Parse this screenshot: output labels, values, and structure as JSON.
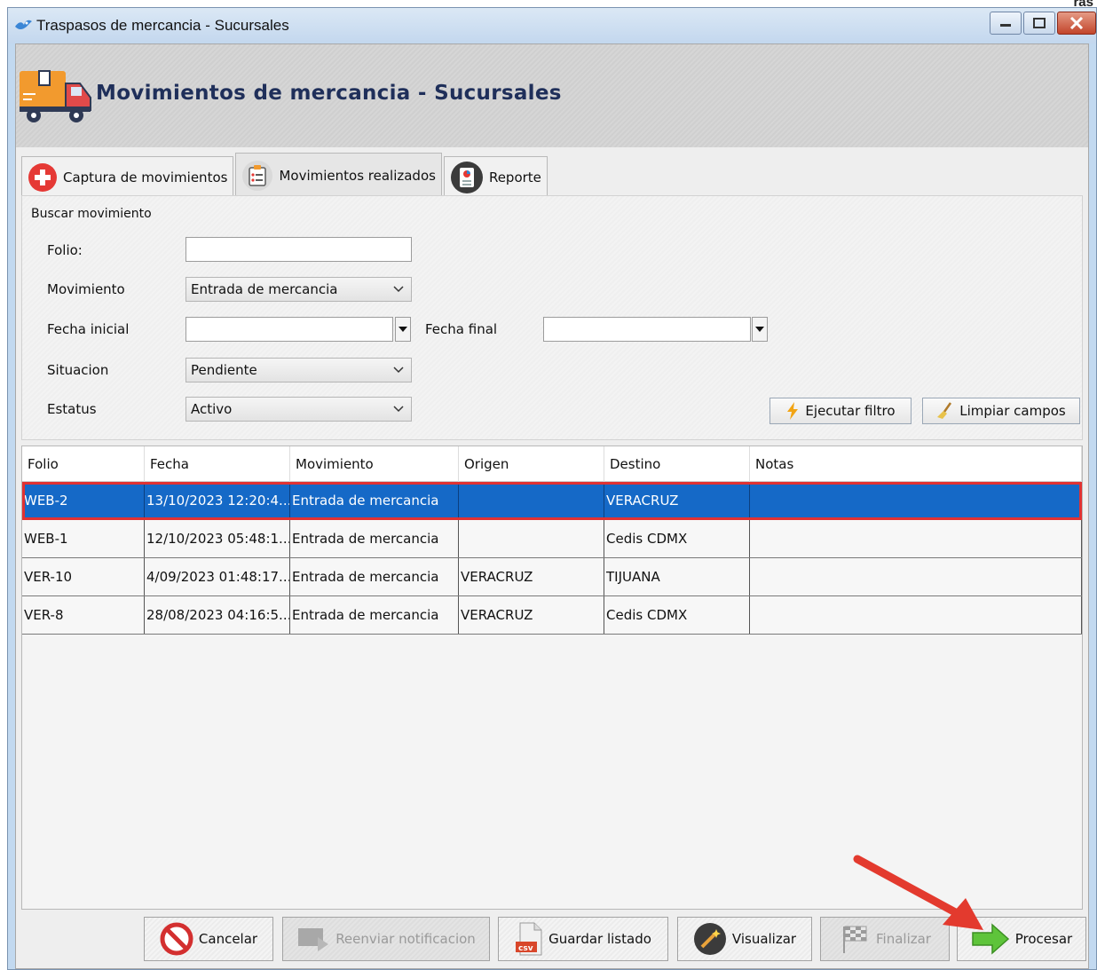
{
  "corner_text": "ras",
  "window": {
    "title": "Traspasos de mercancia - Sucursales"
  },
  "header": {
    "title": "Movimientos de mercancia - Sucursales"
  },
  "tabs": [
    {
      "label": "Captura de movimientos"
    },
    {
      "label": "Movimientos realizados"
    },
    {
      "label": "Reporte"
    }
  ],
  "filter": {
    "group_label": "Buscar movimiento",
    "folio_label": "Folio:",
    "folio_value": "",
    "movimiento_label": "Movimiento",
    "movimiento_value": "Entrada de mercancia",
    "fecha_inicial_label": "Fecha inicial",
    "fecha_inicial_value": "",
    "fecha_final_label": "Fecha final",
    "fecha_final_value": "",
    "situacion_label": "Situacion",
    "situacion_value": "Pendiente",
    "estatus_label": "Estatus",
    "estatus_value": "Activo",
    "ejecutar_label": "Ejecutar filtro",
    "limpiar_label": "Limpiar campos"
  },
  "table": {
    "columns": [
      "Folio",
      "Fecha",
      "Movimiento",
      "Origen",
      "Destino",
      "Notas"
    ],
    "rows": [
      [
        "WEB-2",
        "13/10/2023 12:20:4...",
        "Entrada de mercancia",
        "",
        "VERACRUZ",
        ""
      ],
      [
        "WEB-1",
        "12/10/2023 05:48:1...",
        "Entrada de mercancia",
        "",
        "Cedis CDMX",
        ""
      ],
      [
        "VER-10",
        "4/09/2023 01:48:17...",
        "Entrada de mercancia",
        "VERACRUZ",
        "TIJUANA",
        ""
      ],
      [
        "VER-8",
        "28/08/2023 04:16:5...",
        "Entrada de mercancia",
        "VERACRUZ",
        "Cedis CDMX",
        ""
      ]
    ],
    "selected_row": 0
  },
  "buttons": {
    "cancelar": "Cancelar",
    "reenviar": "Reenviar notificacion",
    "guardar": "Guardar listado",
    "csv_tag": "csv",
    "visualizar": "Visualizar",
    "finalizar": "Finalizar",
    "procesar": "Procesar"
  },
  "colors": {
    "selection": "#1569c7",
    "highlight": "#e03232",
    "title_text": "#1f2f5a"
  }
}
